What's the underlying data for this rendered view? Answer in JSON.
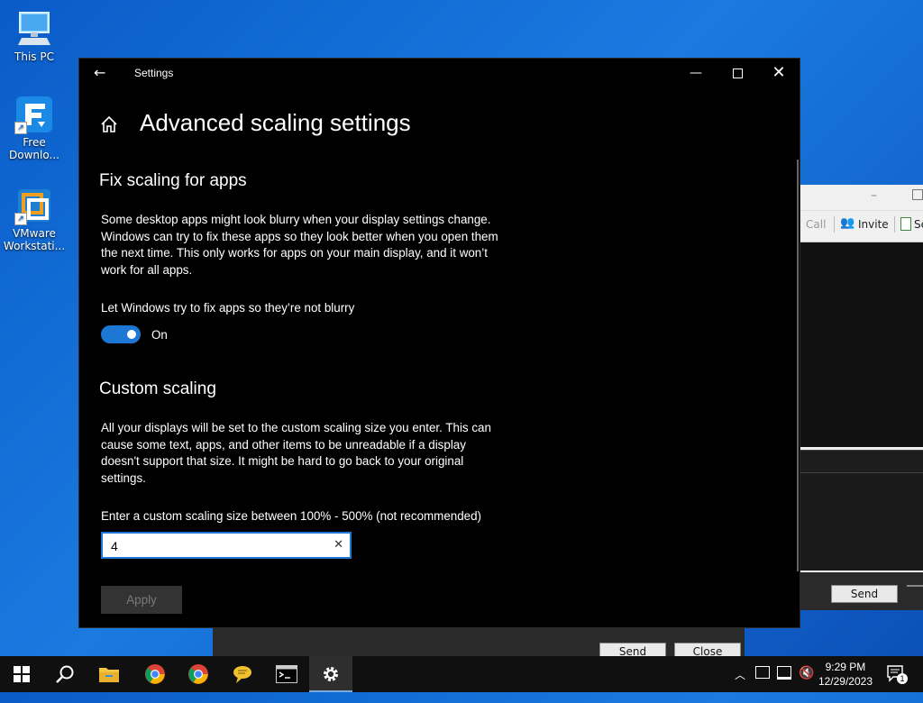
{
  "desktop": {
    "icons": [
      {
        "label": "This PC",
        "icon": "this-pc-icon"
      },
      {
        "label": "Free\nDownlo...",
        "icon": "free-download-manager-icon"
      },
      {
        "label": "VMware\nWorkstati...",
        "icon": "vmware-workstation-icon"
      }
    ]
  },
  "background_window": {
    "toolbar": {
      "call_label": "Call",
      "invite_label": "Invite",
      "se_label": "Se"
    },
    "send_label": "Send"
  },
  "background_window2": {
    "send_label": "Send",
    "close_label": "Close"
  },
  "settings": {
    "window_title": "Settings",
    "page_title": "Advanced scaling settings",
    "fix_section": {
      "heading": "Fix scaling for apps",
      "description": "Some desktop apps might look blurry when your display settings change. Windows can try to fix these apps so they look better when you open them the next time. This only works for apps on your main display, and it won’t work for all apps.",
      "toggle_label": "Let Windows try to fix apps so they’re not blurry",
      "toggle_state": "On",
      "toggle_on": true
    },
    "custom_section": {
      "heading": "Custom scaling",
      "description": "All your displays will be set to the custom scaling size you enter. This can cause some text, apps, and other items to be unreadable if a display doesn't support that size. It might be hard to go back to your original settings.",
      "input_label": "Enter a custom scaling size between 100% - 500% (not recommended)",
      "input_value": "4",
      "apply_label": "Apply"
    }
  },
  "taskbar": {
    "items": [
      "start-icon",
      "search-icon",
      "file-explorer-icon",
      "chrome-icon",
      "chrome-icon",
      "chat-icon",
      "terminal-icon",
      "settings-gear-icon"
    ],
    "clock_time": "9:29 PM",
    "clock_date": "12/29/2023",
    "notification_count": "1"
  },
  "colors": {
    "accent": "#1c78d4",
    "settings_bg": "#000000",
    "taskbar_bg": "#101010"
  }
}
